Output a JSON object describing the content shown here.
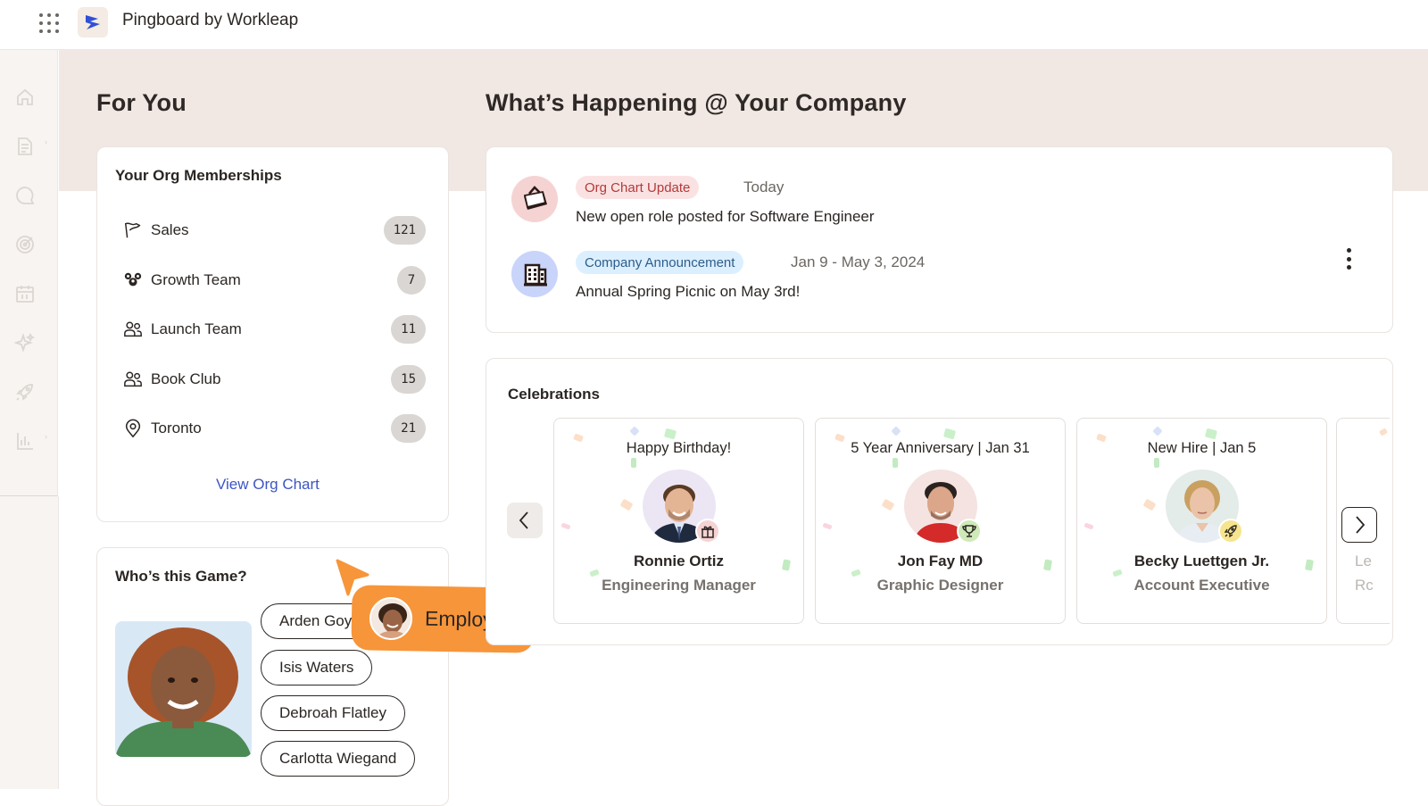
{
  "app": {
    "title": "Pingboard by Workleap",
    "brand_color": "#2f4fd8"
  },
  "sidebar": {
    "items": [
      {
        "icon": "home-icon",
        "label": "Home"
      },
      {
        "icon": "document-icon",
        "label": "Documents",
        "expandable": true
      },
      {
        "icon": "chat-bubble-icon",
        "label": "Chat"
      },
      {
        "icon": "target-icon",
        "label": "Goals"
      },
      {
        "icon": "calendar-icon",
        "label": "Calendar"
      },
      {
        "icon": "sparkle-icon",
        "label": "Highlights"
      },
      {
        "icon": "rocket-icon",
        "label": "Onboarding"
      },
      {
        "icon": "bar-chart-icon",
        "label": "Reports",
        "expandable": true
      }
    ]
  },
  "for_you": {
    "title": "For You",
    "org_memberships": {
      "title": "Your Org Memberships",
      "items": [
        {
          "label": "Sales",
          "count": "121",
          "icon": "flag-icon"
        },
        {
          "label": "Growth Team",
          "count": "7",
          "icon": "team-group-icon"
        },
        {
          "label": "Launch Team",
          "count": "11",
          "icon": "people-icon"
        },
        {
          "label": "Book Club",
          "count": "15",
          "icon": "people-icon"
        },
        {
          "label": "Toronto",
          "count": "21",
          "icon": "location-pin-icon"
        }
      ],
      "view_link": "View Org Chart"
    },
    "game": {
      "title": "Who’s this Game?",
      "options": [
        "Arden Goy",
        "Isis Waters",
        "Debroah Flatley",
        "Carlotta Wiegand"
      ],
      "tooltip_label": "Employee"
    }
  },
  "happening": {
    "title": "What’s Happening @ Your Company",
    "feed": [
      {
        "tag": "Org Chart Update",
        "tag_bg": "#fbe2e2",
        "tag_color": "#b23a3a",
        "icon_bg": "#f6d3d3",
        "date": "Today",
        "text": "New open role posted for Software Engineer",
        "icon": "briefcase-icon"
      },
      {
        "tag": "Company Announcement",
        "tag_bg": "#dcefff",
        "tag_color": "#2c5d8a",
        "icon_bg": "#c9d4fb",
        "date": "Jan 9 - May 3, 2024",
        "text": "Annual Spring Picnic on May 3rd!",
        "icon": "building-icon"
      }
    ],
    "celebrations": {
      "title": "Celebrations",
      "cards": [
        {
          "heading": "Happy Birthday!",
          "name": "Ronnie Ortiz",
          "role": "Engineering Manager",
          "badge": "gift-icon",
          "badge_bg": "#f6d3d3",
          "avatar_bg": "#ece6f4"
        },
        {
          "heading": "5 Year Anniversary | Jan 31",
          "name": "Jon Fay MD",
          "role": "Graphic Designer",
          "badge": "trophy-icon",
          "badge_bg": "#cfe9b8",
          "avatar_bg": "#f4e3e1"
        },
        {
          "heading": "New Hire | Jan 5",
          "name": "Becky Luettgen Jr.",
          "role": "Account Executive",
          "badge": "rocket-icon",
          "badge_bg": "#f6e58e",
          "avatar_bg": "#e3ece8"
        },
        {
          "heading": "",
          "name": "Le",
          "role": "Rc",
          "badge": "",
          "badge_bg": "",
          "avatar_bg": ""
        }
      ]
    }
  }
}
